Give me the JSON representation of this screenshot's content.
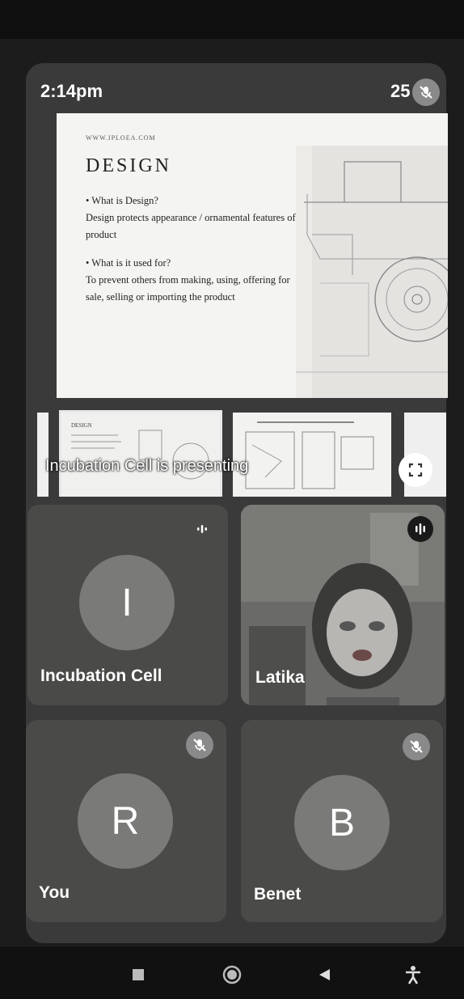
{
  "status": {
    "time": "2:14pm",
    "participant_count": "25"
  },
  "slide": {
    "url": "WWW.IPLOEA.COM",
    "title": "DESIGN",
    "bullets": [
      {
        "question": "• What is Design?",
        "answer": "Design protects appearance / ornamental features of a product"
      },
      {
        "question": "• What is it used for?",
        "answer": "To prevent others from making, using, offering for sale, selling or importing the product"
      }
    ]
  },
  "thumbnails": {
    "first_title": "DESIGN"
  },
  "presenting_label": "Incubation Cell is presenting",
  "participants": [
    {
      "initial": "I",
      "name": "Incubation Cell",
      "state": "speaking"
    },
    {
      "initial": "",
      "name": "Latika",
      "state": "speaking-video"
    },
    {
      "initial": "R",
      "name": "You",
      "state": "muted"
    },
    {
      "initial": "B",
      "name": "Benet",
      "state": "muted"
    }
  ],
  "icons": {
    "mic_off": "mic-off-icon",
    "speaking": "audio-level-icon",
    "fullscreen": "fullscreen-icon",
    "nav": [
      "square-stop-icon",
      "circle-home-icon",
      "triangle-back-icon",
      "accessibility-icon"
    ]
  }
}
